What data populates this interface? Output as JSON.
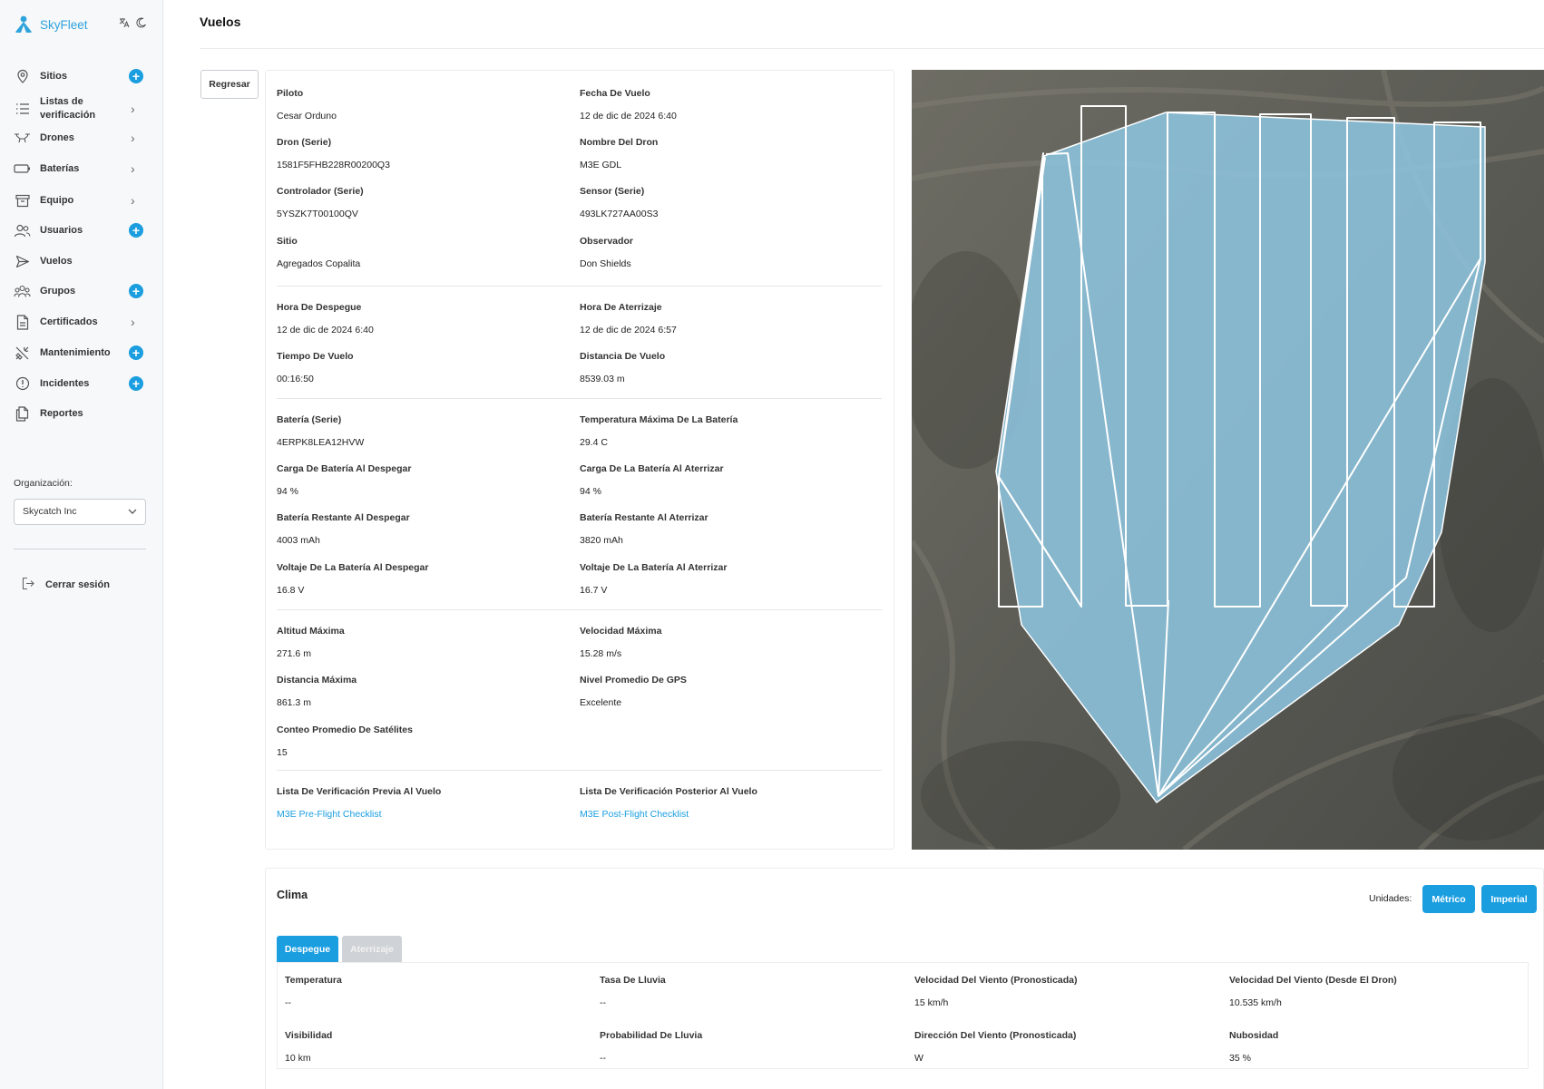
{
  "brand": {
    "name": "SkyFleet",
    "translate_icon": "translate-icon",
    "theme_icon": "moon-icon"
  },
  "sidebar": {
    "items": [
      {
        "label": "Sitios",
        "icon": "map-pin-icon",
        "action": "plus"
      },
      {
        "label": "Listas de verificación",
        "icon": "list-icon",
        "action": "chevron"
      },
      {
        "label": "Drones",
        "icon": "drone-icon",
        "action": "chevron"
      },
      {
        "label": "Baterías",
        "icon": "battery-icon",
        "action": "chevron"
      },
      {
        "label": "Equipo",
        "icon": "archive-icon",
        "action": "chevron"
      },
      {
        "label": "Usuarios",
        "icon": "users-icon",
        "action": "plus"
      },
      {
        "label": "Vuelos",
        "icon": "send-icon",
        "action": "none"
      },
      {
        "label": "Grupos",
        "icon": "group-icon",
        "action": "plus"
      },
      {
        "label": "Certificados",
        "icon": "document-icon",
        "action": "chevron"
      },
      {
        "label": "Mantenimiento",
        "icon": "tools-icon",
        "action": "plus"
      },
      {
        "label": "Incidentes",
        "icon": "alert-circle-icon",
        "action": "plus"
      },
      {
        "label": "Reportes",
        "icon": "files-icon",
        "action": "none"
      }
    ],
    "org_label": "Organización:",
    "org_value": "Skycatch Inc",
    "logout_label": "Cerrar sesión"
  },
  "page": {
    "title": "Vuelos",
    "back_label": "Regresar"
  },
  "details": {
    "piloto": {
      "label": "Piloto",
      "value": "Cesar Orduno"
    },
    "fecha": {
      "label": "Fecha De Vuelo",
      "value": "12 de dic de 2024 6:40"
    },
    "dron_serie": {
      "label": "Dron (Serie)",
      "value": "1581F5FHB228R00200Q3"
    },
    "nombre_dron": {
      "label": "Nombre Del Dron",
      "value": "M3E GDL"
    },
    "controlador": {
      "label": "Controlador (Serie)",
      "value": "5YSZK7T00100QV"
    },
    "sensor": {
      "label": "Sensor (Serie)",
      "value": "493LK727AA00S3"
    },
    "sitio": {
      "label": "Sitio",
      "value": "Agregados Copalita"
    },
    "observador": {
      "label": "Observador",
      "value": "Don Shields"
    },
    "hora_despegue": {
      "label": "Hora De Despegue",
      "value": "12 de dic de 2024 6:40"
    },
    "hora_aterrizaje": {
      "label": "Hora De Aterrizaje",
      "value": "12 de dic de 2024 6:57"
    },
    "tiempo_vuelo": {
      "label": "Tiempo De Vuelo",
      "value": "00:16:50"
    },
    "distancia_vuelo": {
      "label": "Distancia De Vuelo",
      "value": "8539.03 m"
    },
    "bateria_serie": {
      "label": "Batería (Serie)",
      "value": "4ERPK8LEA12HVW"
    },
    "temp_max_bateria": {
      "label": "Temperatura Máxima De La Batería",
      "value": "29.4 C"
    },
    "carga_despegar": {
      "label": "Carga De Batería Al Despegar",
      "value": "94 %"
    },
    "carga_aterrizar": {
      "label": "Carga De La Batería Al Aterrizar",
      "value": "94 %"
    },
    "restante_despegar": {
      "label": "Batería Restante Al Despegar",
      "value": "4003 mAh"
    },
    "restante_aterrizar": {
      "label": "Batería Restante Al Aterrizar",
      "value": "3820 mAh"
    },
    "voltaje_despegar": {
      "label": "Voltaje De La Batería Al Despegar",
      "value": "16.8 V"
    },
    "voltaje_aterrizar": {
      "label": "Voltaje De La Batería Al Aterrizar",
      "value": "16.7 V"
    },
    "altitud_max": {
      "label": "Altitud Máxima",
      "value": "271.6 m"
    },
    "velocidad_max": {
      "label": "Velocidad Máxima",
      "value": "15.28 m/s"
    },
    "distancia_max": {
      "label": "Distancia Máxima",
      "value": "861.3 m"
    },
    "nivel_gps": {
      "label": "Nivel Promedio De GPS",
      "value": "Excelente"
    },
    "satelites": {
      "label": "Conteo Promedio De Satélites",
      "value": "15"
    },
    "checklist_previa": {
      "label": "Lista De Verificación Previa Al Vuelo",
      "value": "M3E Pre-Flight Checklist"
    },
    "checklist_posterior": {
      "label": "Lista De Verificación Posterior Al Vuelo",
      "value": "M3E Post-Flight Checklist"
    }
  },
  "weather": {
    "title": "Clima",
    "units_label": "Unidades:",
    "metric_label": "Métrico",
    "imperial_label": "Imperial",
    "tab_takeoff": "Despegue",
    "tab_landing": "Aterrizaje",
    "temperatura": {
      "label": "Temperatura",
      "value": "--"
    },
    "tasa_lluvia": {
      "label": "Tasa De Lluvia",
      "value": "--"
    },
    "viento_pron": {
      "label": "Velocidad Del Viento (Pronosticada)",
      "value": "15 km/h"
    },
    "viento_dron": {
      "label": "Velocidad Del Viento (Desde El Dron)",
      "value": "10.535 km/h"
    },
    "visibilidad": {
      "label": "Visibilidad",
      "value": "10 km"
    },
    "prob_lluvia": {
      "label": "Probabilidad De Lluvia",
      "value": "--"
    },
    "direccion_viento": {
      "label": "Dirección Del Viento (Pronosticada)",
      "value": "W"
    },
    "nubosidad": {
      "label": "Nubosidad",
      "value": "35 %"
    }
  },
  "colors": {
    "accent": "#1a9ee0",
    "polygon_fill": "#8ec7e2",
    "path": "#ffffff"
  }
}
